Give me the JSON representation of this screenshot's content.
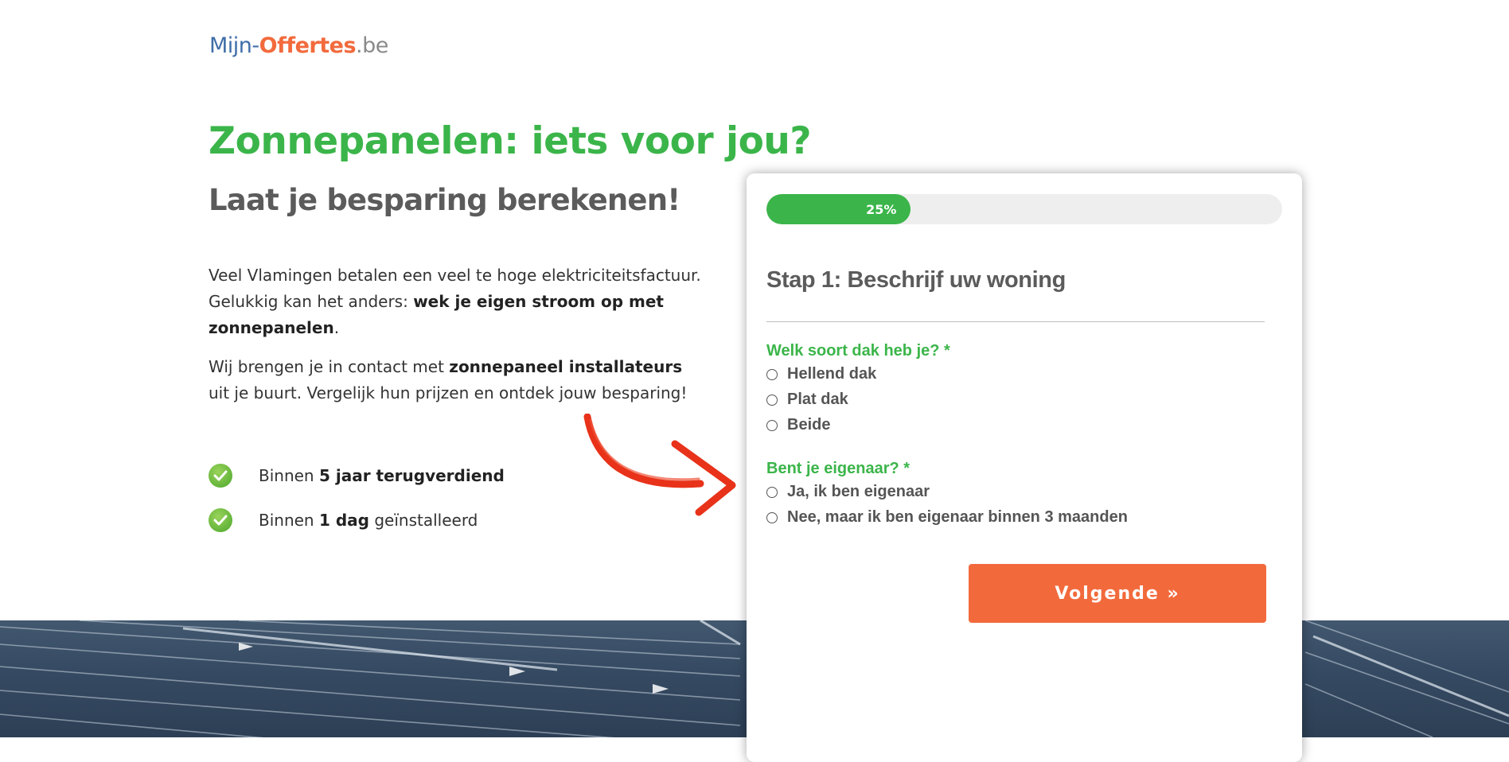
{
  "logo": {
    "part1": "Mijn-",
    "part2": "Offertes",
    "part3": ".be"
  },
  "hero": {
    "title": "Zonnepanelen: iets voor jou?",
    "subtitle": "Laat je besparing berekenen!"
  },
  "intro": {
    "p1_a": "Veel Vlamingen betalen een veel te hoge elektriciteitsfactuur. Gelukkig kan het anders: ",
    "p1_b": "wek je eigen stroom op met zonnepanelen",
    "p1_c": ".",
    "p2_a": "Wij brengen je in contact met ",
    "p2_b": "zonnepaneel installateurs",
    "p2_c": " uit je buurt. Vergelijk hun prijzen en ontdek jouw besparing!"
  },
  "features": [
    {
      "pre": "Binnen ",
      "bold": "5 jaar terugverdiend",
      "post": ""
    },
    {
      "pre": "Binnen ",
      "bold": "1 dag",
      "post": " geïnstalleerd"
    }
  ],
  "form": {
    "progress_label": "25%",
    "progress_value": 0.25,
    "step_title": "Stap 1: Beschrijf uw woning",
    "q1": {
      "label": "Welk soort dak heb je? *",
      "options": [
        "Hellend dak",
        "Plat dak",
        "Beide"
      ]
    },
    "q2": {
      "label": "Bent je eigenaar? *",
      "options": [
        "Ja, ik ben eigenaar",
        "Nee, maar ik ben eigenaar binnen 3 maanden"
      ]
    },
    "next_label": "Volgende »"
  },
  "colors": {
    "green": "#3bb54a",
    "orange": "#f26a3c",
    "blue": "#3f6ea8",
    "arrow_red": "#e8321a"
  },
  "icons": {
    "check": "check-circle-icon",
    "arrow": "curved-arrow-icon"
  }
}
